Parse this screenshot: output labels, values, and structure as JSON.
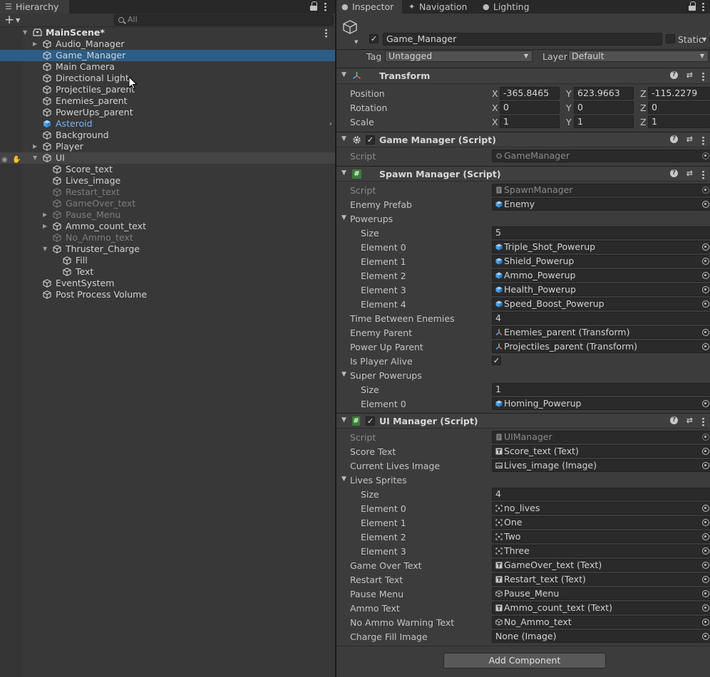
{
  "hierarchy": {
    "tab_label": "Hierarchy",
    "search_placeholder": "All",
    "items": [
      {
        "label": "MainScene*",
        "depth": 0,
        "type": "scene",
        "arrow": "down",
        "state": "normal"
      },
      {
        "label": "Audio_Manager",
        "depth": 1,
        "arrow": "right",
        "state": "normal"
      },
      {
        "label": "Game_Manager",
        "depth": 1,
        "arrow": "",
        "state": "selected"
      },
      {
        "label": "Main Camera",
        "depth": 1,
        "arrow": "",
        "state": "normal"
      },
      {
        "label": "Directional Light",
        "depth": 1,
        "arrow": "",
        "state": "normal"
      },
      {
        "label": "Projectiles_parent",
        "depth": 1,
        "arrow": "",
        "state": "normal"
      },
      {
        "label": "Enemies_parent",
        "depth": 1,
        "arrow": "",
        "state": "normal"
      },
      {
        "label": "PowerUps_parent",
        "depth": 1,
        "arrow": "",
        "state": "normal"
      },
      {
        "label": "Asteroid",
        "depth": 1,
        "arrow": "",
        "state": "prefab"
      },
      {
        "label": "Background",
        "depth": 1,
        "arrow": "",
        "state": "normal"
      },
      {
        "label": "Player",
        "depth": 1,
        "arrow": "right",
        "state": "normal"
      },
      {
        "label": "UI",
        "depth": 1,
        "arrow": "down",
        "state": "hovered"
      },
      {
        "label": "Score_text",
        "depth": 2,
        "arrow": "",
        "state": "normal"
      },
      {
        "label": "Lives_image",
        "depth": 2,
        "arrow": "",
        "state": "normal"
      },
      {
        "label": "Restart_text",
        "depth": 2,
        "arrow": "",
        "state": "disabled"
      },
      {
        "label": "GameOver_text",
        "depth": 2,
        "arrow": "",
        "state": "disabled"
      },
      {
        "label": "Pause_Menu",
        "depth": 2,
        "arrow": "right",
        "state": "disabled"
      },
      {
        "label": "Ammo_count_text",
        "depth": 2,
        "arrow": "right",
        "state": "normal"
      },
      {
        "label": "No_Ammo_text",
        "depth": 2,
        "arrow": "",
        "state": "disabled"
      },
      {
        "label": "Thruster_Charge",
        "depth": 2,
        "arrow": "down",
        "state": "normal"
      },
      {
        "label": "Fill",
        "depth": 3,
        "arrow": "",
        "state": "normal"
      },
      {
        "label": "Text",
        "depth": 3,
        "arrow": "",
        "state": "normal"
      },
      {
        "label": "EventSystem",
        "depth": 1,
        "arrow": "",
        "state": "normal"
      },
      {
        "label": "Post Process Volume",
        "depth": 1,
        "arrow": "",
        "state": "normal"
      }
    ]
  },
  "inspector": {
    "tabs": [
      "Inspector",
      "Navigation",
      "Lighting"
    ],
    "object_name": "Game_Manager",
    "static_label": "Static",
    "tag_label": "Tag",
    "tag_value": "Untagged",
    "layer_label": "Layer",
    "layer_value": "Default",
    "transform": {
      "title": "Transform",
      "position_label": "Position",
      "rotation_label": "Rotation",
      "scale_label": "Scale",
      "position": [
        "-365.8465",
        "623.9663",
        "-115.2279"
      ],
      "rotation": [
        "0",
        "0",
        "0"
      ],
      "scale": [
        "1",
        "1",
        "1"
      ],
      "axes": [
        "X",
        "Y",
        "Z"
      ]
    },
    "game_manager": {
      "title": "Game Manager (Script)",
      "script_label": "Script",
      "script_value": "GameManager"
    },
    "spawn_manager": {
      "title": "Spawn Manager (Script)",
      "rows": [
        {
          "label": "Script",
          "value": "SpawnManager",
          "indent": 0,
          "kind": "script"
        },
        {
          "label": "Enemy Prefab",
          "value": "Enemy",
          "indent": 0,
          "kind": "prefab"
        },
        {
          "label": "Powerups",
          "value": "",
          "indent": 0,
          "kind": "foldout"
        },
        {
          "label": "Size",
          "value": "5",
          "indent": 1,
          "kind": "num"
        },
        {
          "label": "Element 0",
          "value": "Triple_Shot_Powerup",
          "indent": 1,
          "kind": "prefab"
        },
        {
          "label": "Element 1",
          "value": "Shield_Powerup",
          "indent": 1,
          "kind": "prefab"
        },
        {
          "label": "Element 2",
          "value": "Ammo_Powerup",
          "indent": 1,
          "kind": "prefab"
        },
        {
          "label": "Element 3",
          "value": "Health_Powerup",
          "indent": 1,
          "kind": "prefab"
        },
        {
          "label": "Element 4",
          "value": "Speed_Boost_Powerup",
          "indent": 1,
          "kind": "prefab"
        },
        {
          "label": "Time Between Enemies",
          "value": "4",
          "indent": 0,
          "kind": "num"
        },
        {
          "label": "Enemy Parent",
          "value": "Enemies_parent (Transform)",
          "indent": 0,
          "kind": "transform"
        },
        {
          "label": "Power Up Parent",
          "value": "Projectiles_parent (Transform)",
          "indent": 0,
          "kind": "transform"
        },
        {
          "label": "Is Player Alive",
          "value": "✓",
          "indent": 0,
          "kind": "check"
        },
        {
          "label": "Super Powerups",
          "value": "",
          "indent": 0,
          "kind": "foldout"
        },
        {
          "label": "Size",
          "value": "1",
          "indent": 1,
          "kind": "num"
        },
        {
          "label": "Element 0",
          "value": "Homing_Powerup",
          "indent": 1,
          "kind": "prefab"
        }
      ]
    },
    "ui_manager": {
      "title": "UI Manager (Script)",
      "rows": [
        {
          "label": "Script",
          "value": "UIManager",
          "indent": 0,
          "kind": "script"
        },
        {
          "label": "Score Text",
          "value": "Score_text (Text)",
          "indent": 0,
          "kind": "text"
        },
        {
          "label": "Current Lives Image",
          "value": "Lives_image (Image)",
          "indent": 0,
          "kind": "image"
        },
        {
          "label": "Lives Sprites",
          "value": "",
          "indent": 0,
          "kind": "foldout"
        },
        {
          "label": "Size",
          "value": "4",
          "indent": 1,
          "kind": "num"
        },
        {
          "label": "Element 0",
          "value": "no_lives",
          "indent": 1,
          "kind": "sprite"
        },
        {
          "label": "Element 1",
          "value": "One",
          "indent": 1,
          "kind": "sprite"
        },
        {
          "label": "Element 2",
          "value": "Two",
          "indent": 1,
          "kind": "sprite"
        },
        {
          "label": "Element 3",
          "value": "Three",
          "indent": 1,
          "kind": "sprite"
        },
        {
          "label": "Game Over Text",
          "value": "GameOver_text (Text)",
          "indent": 0,
          "kind": "text"
        },
        {
          "label": "Restart Text",
          "value": "Restart_text (Text)",
          "indent": 0,
          "kind": "text"
        },
        {
          "label": "Pause Menu",
          "value": "Pause_Menu",
          "indent": 0,
          "kind": "gameobject"
        },
        {
          "label": "Ammo Text",
          "value": "Ammo_count_text (Text)",
          "indent": 0,
          "kind": "text"
        },
        {
          "label": "No Ammo Warning Text",
          "value": "No_Ammo_text",
          "indent": 0,
          "kind": "gameobject"
        },
        {
          "label": "Charge Fill Image",
          "value": "None (Image)",
          "indent": 0,
          "kind": "none"
        }
      ]
    },
    "add_component_label": "Add Component"
  },
  "colors": {
    "selection": "#2c5d87",
    "prefab_text": "#7cb4f2",
    "panel": "#3c3c3c"
  }
}
